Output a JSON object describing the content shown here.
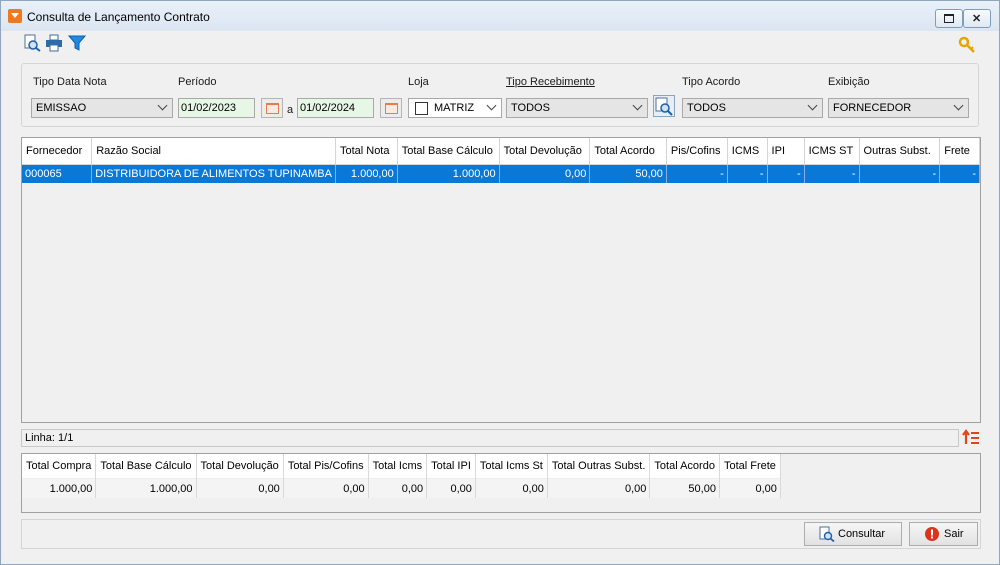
{
  "window": {
    "title": "Consulta de Lançamento Contrato"
  },
  "toolbar": {
    "icons": [
      "search-document-icon",
      "print-icon",
      "filter-icon",
      "key-icon"
    ]
  },
  "filters": {
    "tipo_data_nota": {
      "label": "Tipo Data Nota",
      "value": "EMISSAO"
    },
    "periodo": {
      "label": "Período",
      "start": "01/02/2023",
      "separator": "a",
      "end": "01/02/2024"
    },
    "loja": {
      "label": "Loja",
      "value": "MATRIZ",
      "checked": false
    },
    "tipo_recebimento": {
      "label": "Tipo Recebimento",
      "value": "TODOS"
    },
    "tipo_acordo": {
      "label": "Tipo Acordo",
      "value": "TODOS"
    },
    "exibicao": {
      "label": "Exibição",
      "value": "FORNECEDOR"
    }
  },
  "grid": {
    "columns": [
      "Fornecedor",
      "Razão Social",
      "Total Nota",
      "Total Base Cálculo",
      "Total Devolução",
      "Total Acordo",
      "Pis/Cofins",
      "ICMS",
      "IPI",
      "ICMS ST",
      "Outras Subst.",
      "Frete"
    ],
    "rows": [
      [
        "000065",
        "DISTRIBUIDORA DE ALIMENTOS TUPINAMBA",
        "1.000,00",
        "1.000,00",
        "0,00",
        "50,00",
        "-",
        "-",
        "-",
        "-",
        "-",
        "-"
      ]
    ],
    "selected_row": 0
  },
  "status": {
    "linha": "Linha: 1/1"
  },
  "totals": {
    "columns": [
      "Total Compra",
      "Total Base Cálculo",
      "Total Devolução",
      "Total Pis/Cofins",
      "Total Icms",
      "Total IPI",
      "Total Icms St",
      "Total Outras Subst.",
      "Total Acordo",
      "Total Frete"
    ],
    "values": [
      "1.000,00",
      "1.000,00",
      "0,00",
      "0,00",
      "0,00",
      "0,00",
      "0,00",
      "0,00",
      "50,00",
      "0,00"
    ]
  },
  "buttons": {
    "consultar": "Consultar",
    "sair": "Sair"
  },
  "colors": {
    "selection": "#0a78d7",
    "accent_orange": "#f0781e",
    "calendar_orange": "#e87b4e",
    "exit_red": "#d9341e"
  }
}
